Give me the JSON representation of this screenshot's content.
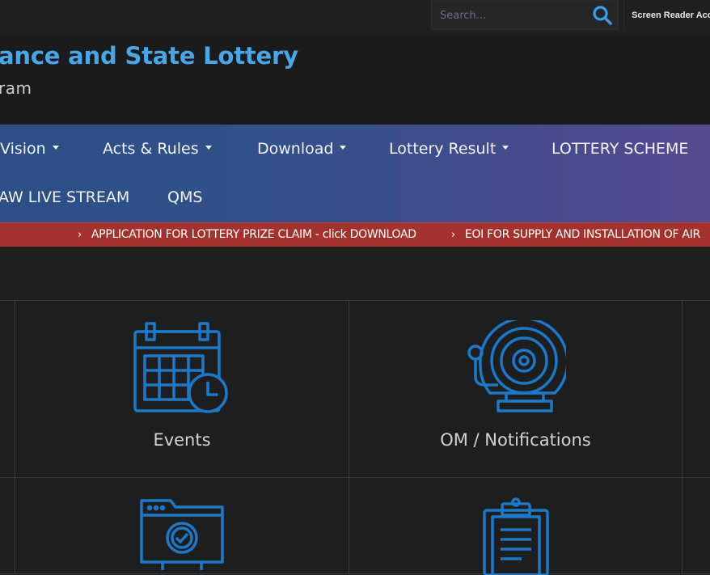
{
  "search": {
    "placeholder": "Search..."
  },
  "topbar": {
    "screen_reader_label": "Screen Reader Acc"
  },
  "header": {
    "title": "ance and State Lottery",
    "subtitle": "ram"
  },
  "nav": {
    "items": [
      {
        "label": "Vision",
        "dropdown": true
      },
      {
        "label": "Acts & Rules",
        "dropdown": true
      },
      {
        "label": "Download",
        "dropdown": true
      },
      {
        "label": "Lottery Result",
        "dropdown": true
      },
      {
        "label": "LOTTERY SCHEME",
        "dropdown": false
      },
      {
        "label": "AW LIVE STREAM",
        "dropdown": false
      },
      {
        "label": "QMS",
        "dropdown": false
      }
    ]
  },
  "ticker": {
    "items": [
      "APPLICATION  FOR  LOTTERY  PRIZE  CLAIM - click DOWNLOAD",
      "EOI FOR SUPPLY AND INSTALLATION OF AIR"
    ]
  },
  "tiles": [
    {
      "label": "Events",
      "icon": "calendar-clock-icon"
    },
    {
      "label": "OM / Notifications",
      "icon": "bell-icon"
    },
    {
      "label": "",
      "icon": "folder-check-icon"
    },
    {
      "label": "",
      "icon": "clipboard-icon"
    }
  ],
  "colors": {
    "accent": "#4aa6e6",
    "icon": "#1e78c8",
    "ticker_bg": "#a3322d",
    "nav_start": "#2b4f86",
    "nav_end": "#564b8e",
    "background": "#1f2022"
  }
}
